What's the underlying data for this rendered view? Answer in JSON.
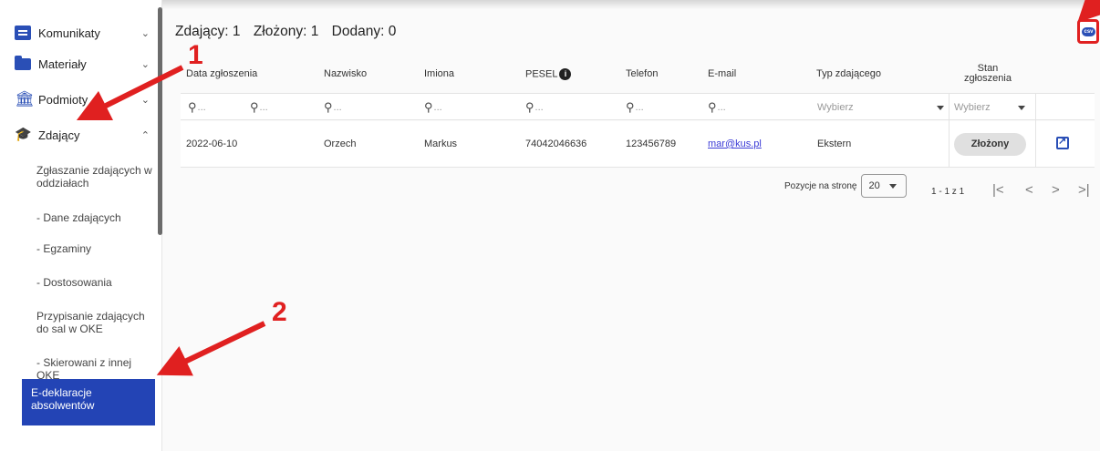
{
  "sidebar": {
    "items": [
      {
        "label": "Komunikaty",
        "icon": "message-icon"
      },
      {
        "label": "Materiały",
        "icon": "folder-icon"
      },
      {
        "label": "Podmioty",
        "icon": "bank-icon"
      },
      {
        "label": "Zdający",
        "icon": "graduation-cap-icon"
      }
    ],
    "subitems": [
      "Zgłaszanie zdających w oddziałach",
      "- Dane zdających",
      "- Egzaminy",
      "- Dostosowania",
      "Przypisanie zdających do sal w OKE",
      "- Skierowani z innej OKE",
      "E-deklaracje absolwentów"
    ]
  },
  "header": {
    "zdajacy": "Zdający: 1",
    "zlozony": "Złożony: 1",
    "dodany": "Dodany: 0"
  },
  "csv_label": "csv",
  "table": {
    "columns": [
      "Data zgłoszenia",
      "Nazwisko",
      "Imiona",
      "PESEL",
      "Telefon",
      "E-mail",
      "Typ zdającego",
      "Stan zgłoszenia"
    ],
    "filter_placeholder": "...",
    "select_placeholder": "Wybierz",
    "row": {
      "date": "2022-06-10",
      "nazwisko": "Orzech",
      "imiona": "Markus",
      "pesel": "74042046636",
      "telefon": "123456789",
      "email": "mar@kus.pl",
      "typ": "Ekstern",
      "stan": "Złożony"
    }
  },
  "pager": {
    "label": "Pozycje na stronę",
    "size": "20",
    "range": "1 - 1 z 1"
  },
  "annotations": {
    "one": "1",
    "two": "2",
    "color": "#e02020"
  }
}
